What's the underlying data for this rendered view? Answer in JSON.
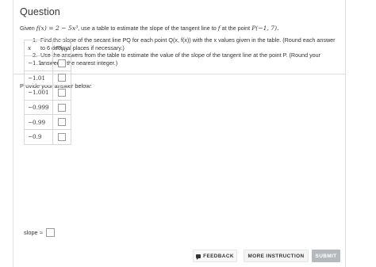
{
  "question": {
    "heading": "Question",
    "stem_pre": "Given",
    "function": "f(x) = 2 − 5x³",
    "stem_mid": ", use a table to estimate the slope of the tangent line to",
    "f_symbol": "f",
    "stem_point_pre": "at the point",
    "point": "P(−1, 7).",
    "part1": "Find the slope of the secant line PQ for each point Q(x, f(x)) with the x values given in the table. (Round each answer to 6 decimal places if necessary.)",
    "part2": "Use the answers from the table to estimate the value of the slope of the tangent line at the point P. (Round your answer to the nearest integer.)"
  },
  "answer": {
    "prompt": "Provide your answer below:",
    "table": {
      "header_x": "x",
      "header_m": "m",
      "header_m_sub": "PQ",
      "rows": [
        "−1.1",
        "−1.01",
        "−1.001",
        "−0.999",
        "−0.99",
        "−0.9"
      ]
    },
    "slope_label": "slope ≈"
  },
  "footer": {
    "feedback": "FEEDBACK",
    "more_instruction": "MORE INSTRUCTION",
    "submit": "SUBMIT"
  }
}
